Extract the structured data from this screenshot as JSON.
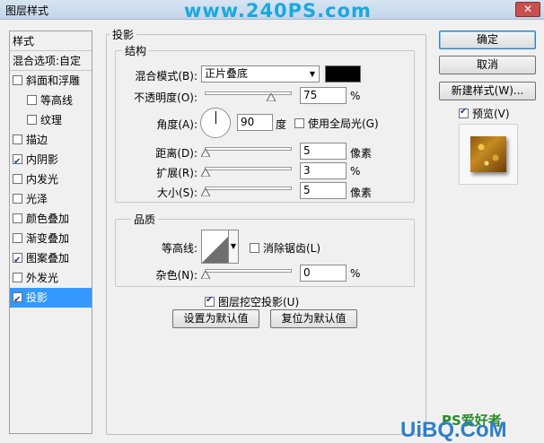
{
  "window": {
    "title": "图层样式",
    "close_label": "✕",
    "watermark": "www.240PS.com"
  },
  "left": {
    "header_styles": "样式",
    "header_blend": "混合选项:自定",
    "items": [
      {
        "label": "斜面和浮雕",
        "checked": false,
        "sub": false
      },
      {
        "label": "等高线",
        "checked": false,
        "sub": true
      },
      {
        "label": "纹理",
        "checked": false,
        "sub": true
      },
      {
        "label": "描边",
        "checked": false,
        "sub": false
      },
      {
        "label": "内阴影",
        "checked": true,
        "sub": false
      },
      {
        "label": "内发光",
        "checked": false,
        "sub": false
      },
      {
        "label": "光泽",
        "checked": false,
        "sub": false
      },
      {
        "label": "颜色叠加",
        "checked": false,
        "sub": false
      },
      {
        "label": "渐变叠加",
        "checked": false,
        "sub": false
      },
      {
        "label": "图案叠加",
        "checked": true,
        "sub": false
      },
      {
        "label": "外发光",
        "checked": false,
        "sub": false
      },
      {
        "label": "投影",
        "checked": true,
        "sub": false,
        "selected": true
      }
    ]
  },
  "panel": {
    "section_title": "投影",
    "structure": {
      "title": "结构",
      "blend_mode_label": "混合模式(B):",
      "blend_mode_value": "正片叠底",
      "shadow_color": "#000000",
      "opacity_label": "不透明度(O):",
      "opacity_value": "75",
      "opacity_unit": "%",
      "opacity_level": 75,
      "angle_label": "角度(A):",
      "angle_value": "90",
      "angle_unit": "度",
      "global_light_label": "使用全局光(G)",
      "global_light_checked": false,
      "distance_label": "距离(D):",
      "distance_value": "5",
      "distance_unit": "像素",
      "spread_label": "扩展(R):",
      "spread_value": "3",
      "spread_unit": "%",
      "size_label": "大小(S):",
      "size_value": "5",
      "size_unit": "像素"
    },
    "quality": {
      "title": "品质",
      "contour_label": "等高线:",
      "antialias_label": "消除锯齿(L)",
      "antialias_checked": false,
      "noise_label": "杂色(N):",
      "noise_value": "0",
      "noise_unit": "%"
    },
    "knockout_label": "图层挖空投影(U)",
    "knockout_checked": true,
    "make_default": "设置为默认值",
    "reset_default": "复位为默认值"
  },
  "right": {
    "ok": "确定",
    "cancel": "取消",
    "new_style": "新建样式(W)...",
    "preview_label": "预览(V)",
    "preview_checked": true
  },
  "bottom_watermark": {
    "logo_text": "PS爱好者",
    "url": "UiBQ.CoM"
  }
}
